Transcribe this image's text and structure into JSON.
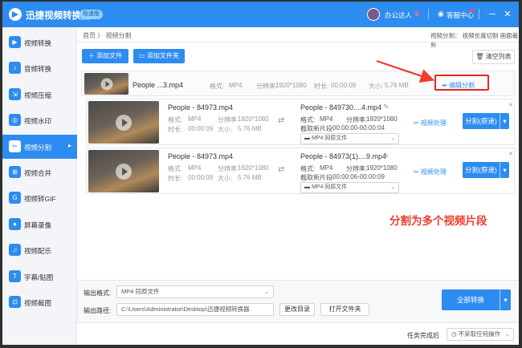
{
  "app": {
    "title": "迅捷视频转换器",
    "badge": "极速版",
    "user": "办公达人",
    "service": "客服中心"
  },
  "sidebar": {
    "items": [
      {
        "label": "视频转换",
        "icon": "video-convert-icon",
        "glyph": "▶"
      },
      {
        "label": "音频转换",
        "icon": "audio-convert-icon",
        "glyph": "♪"
      },
      {
        "label": "视频压缩",
        "icon": "compress-icon",
        "glyph": "⇲"
      },
      {
        "label": "视频水印",
        "icon": "watermark-icon",
        "glyph": "◎"
      },
      {
        "label": "视频分割",
        "icon": "split-icon",
        "glyph": "✂"
      },
      {
        "label": "视频合并",
        "icon": "merge-icon",
        "glyph": "⊞"
      },
      {
        "label": "视频转GIF",
        "icon": "gif-icon",
        "glyph": "G"
      },
      {
        "label": "屏幕录像",
        "icon": "screen-record-icon",
        "glyph": "●"
      },
      {
        "label": "视频配乐",
        "icon": "music-icon",
        "glyph": "♫"
      },
      {
        "label": "字幕/贴图",
        "icon": "subtitle-icon",
        "glyph": "T"
      },
      {
        "label": "视频截图",
        "icon": "screenshot-icon",
        "glyph": "⊡"
      }
    ],
    "active_index": 4
  },
  "breadcrumb": {
    "home": "首页",
    "sep": "〉",
    "current": "视频分割"
  },
  "split_mode": {
    "label": "视频分割：",
    "option1": "视频长度切割",
    "option2": "画面裁剪"
  },
  "toolbar": {
    "add_file": "添加文件",
    "add_folder": "添加文件夹",
    "clear_list": "清空列表"
  },
  "source": {
    "name": "People ...3.mp4",
    "format_label": "格式:",
    "format": "MP4",
    "res_label": "分辨率:",
    "resolution": "1920*1080",
    "dur_label": "时长:",
    "duration": "00:00:09",
    "size_label": "大小:",
    "size": "5.76 MB",
    "edit_split": "编辑分割"
  },
  "segments": [
    {
      "name": "People - 84973.mp4",
      "format_label": "格式:",
      "format": "MP4",
      "res_label": "分辨率:",
      "resolution": "1920*1080",
      "dur_label": "时长:",
      "duration": "00:00:09",
      "size_label": "大小:",
      "size": "5.76 MB",
      "out_name": "People - 849730....4.mp4",
      "out_format": "MP4",
      "out_resolution": "1920*1080",
      "cut_label": "截取新片段:",
      "cut_range": "00:00:00-00:00:04",
      "out_select": "MP4 同原文件",
      "process": "视频处理",
      "split_btn": "分割(原速)"
    },
    {
      "name": "People - 84973.mp4",
      "format_label": "格式:",
      "format": "MP4",
      "res_label": "分辨率:",
      "resolution": "1920*1080",
      "dur_label": "时长:",
      "duration": "00:00:09",
      "size_label": "大小:",
      "size": "5.76 MB",
      "out_name": "People - 84973(1)....9.mp4",
      "out_format": "MP4",
      "out_resolution": "1920*1080",
      "cut_label": "截取新片段:",
      "cut_range": "00:00:06-00:00:09",
      "out_select": "MP4 同原文件",
      "process": "视频处理",
      "split_btn": "分割(原速)"
    }
  ],
  "annotation": "分割为多个视频片段",
  "output": {
    "format_label": "输出格式:",
    "format_value": "MP4 同原文件",
    "path_label": "输出路径:",
    "path_value": "C:\\Users\\Administrator\\Desktop\\迅捷视频转换器",
    "change_dir": "更改目录",
    "open_folder": "打开文件夹",
    "convert_all": "全部转换"
  },
  "footer": {
    "label": "任务完成后",
    "select": "不采取任何操作"
  },
  "colors": {
    "brand": "#2d8cf0",
    "annotation": "#f23a2e"
  }
}
